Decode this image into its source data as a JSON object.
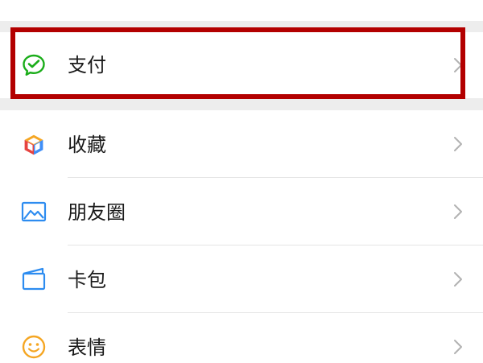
{
  "menu": {
    "items": [
      {
        "label": "支付",
        "icon": "wechat-pay-icon"
      },
      {
        "label": "收藏",
        "icon": "favorites-cube-icon"
      },
      {
        "label": "朋友圈",
        "icon": "moments-image-icon"
      },
      {
        "label": "卡包",
        "icon": "card-wallet-icon"
      },
      {
        "label": "表情",
        "icon": "emoji-smile-icon"
      }
    ]
  },
  "colors": {
    "highlight": "#b30000",
    "pay_green": "#1aad19",
    "background": "#ededed",
    "chevron": "#b2b2b2"
  }
}
